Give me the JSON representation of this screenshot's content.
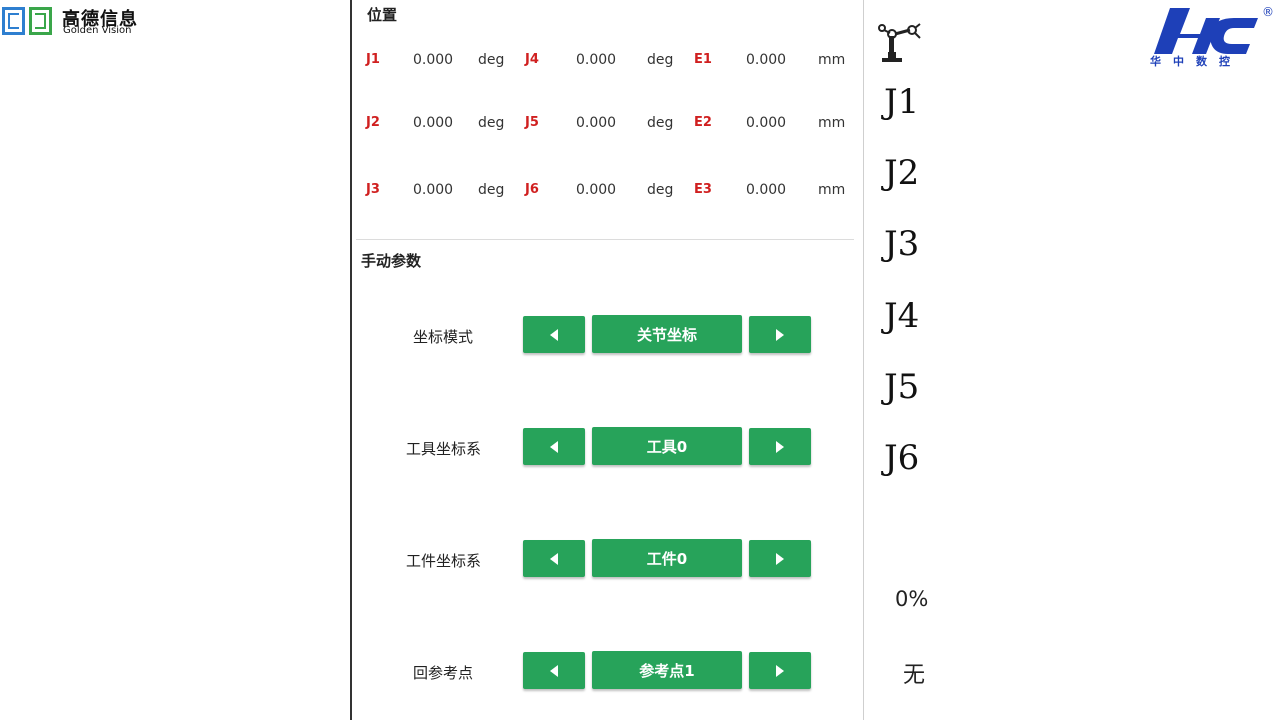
{
  "left_logo": {
    "cn": "高德信息",
    "en": "Golden Vision"
  },
  "right_logo": {
    "text": "HNC",
    "cn": "华中数控",
    "reg": "®"
  },
  "position": {
    "title": "位置",
    "rows": [
      [
        {
          "label": "J1",
          "value": "0.000",
          "unit": "deg"
        },
        {
          "label": "J4",
          "value": "0.000",
          "unit": "deg"
        },
        {
          "label": "E1",
          "value": "0.000",
          "unit": "mm"
        }
      ],
      [
        {
          "label": "J2",
          "value": "0.000",
          "unit": "deg"
        },
        {
          "label": "J5",
          "value": "0.000",
          "unit": "deg"
        },
        {
          "label": "E2",
          "value": "0.000",
          "unit": "mm"
        }
      ],
      [
        {
          "label": "J3",
          "value": "0.000",
          "unit": "deg"
        },
        {
          "label": "J6",
          "value": "0.000",
          "unit": "deg"
        },
        {
          "label": "E3",
          "value": "0.000",
          "unit": "mm"
        }
      ]
    ]
  },
  "manual": {
    "title": "手动参数",
    "params": [
      {
        "label": "坐标模式",
        "value": "关节坐标"
      },
      {
        "label": "工具坐标系",
        "value": "工具0"
      },
      {
        "label": "工件坐标系",
        "value": "工件0"
      },
      {
        "label": "回参考点",
        "value": "参考点1"
      }
    ]
  },
  "right_panel": {
    "joints": [
      "J1",
      "J2",
      "J3",
      "J4",
      "J5",
      "J6"
    ],
    "speed": "0%",
    "status": "无"
  },
  "colors": {
    "button": "#27a35a",
    "axis_label": "#d02020",
    "logo_blue": "#1e40b8"
  }
}
